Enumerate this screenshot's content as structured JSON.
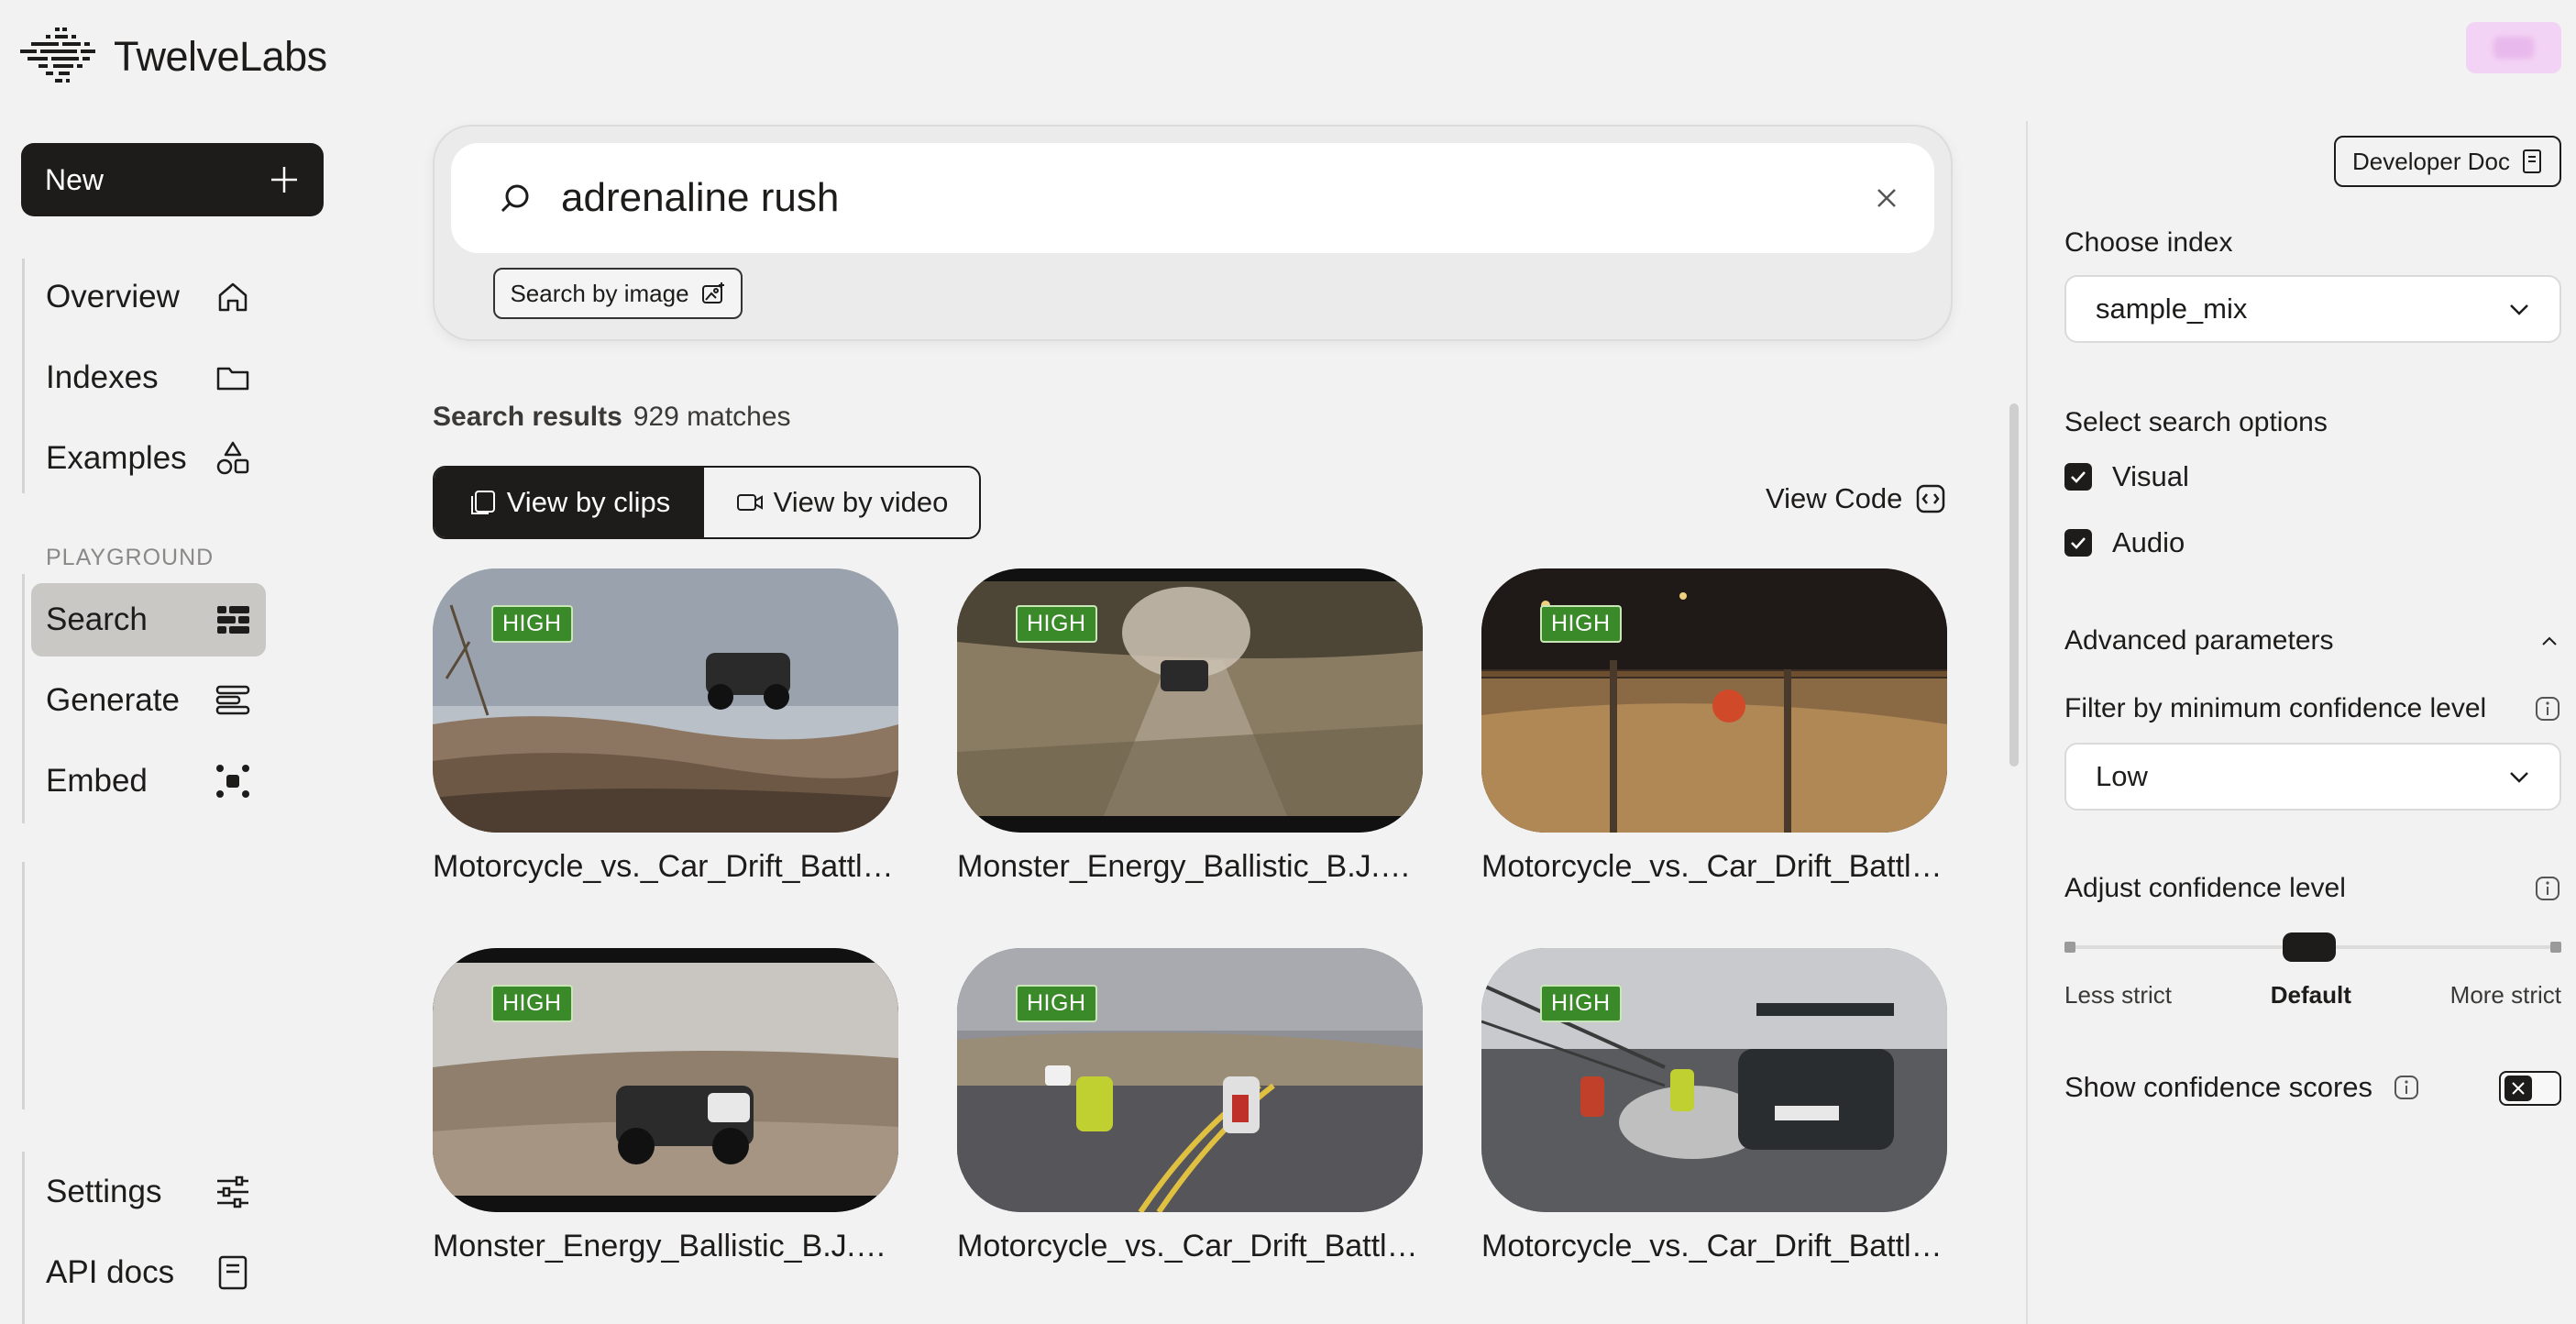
{
  "brand": {
    "name": "TwelveLabs"
  },
  "sidebar": {
    "new_label": "New",
    "items": [
      {
        "label": "Overview"
      },
      {
        "label": "Indexes"
      },
      {
        "label": "Examples"
      }
    ],
    "section_label": "PLAYGROUND",
    "playground": [
      {
        "label": "Search",
        "active": true
      },
      {
        "label": "Generate"
      },
      {
        "label": "Embed"
      }
    ],
    "bottom": [
      {
        "label": "Settings"
      },
      {
        "label": "API docs"
      }
    ]
  },
  "search": {
    "query": "adrenaline rush",
    "image_button": "Search by image"
  },
  "results": {
    "title": "Search results",
    "count": "929 matches",
    "view_clips": "View by clips",
    "view_video": "View by video",
    "view_code": "View Code",
    "items": [
      {
        "title": "Motorcycle_vs._Car_Drift_Battle...",
        "badge": "HIGH"
      },
      {
        "title": "Monster_Energy_Ballistic_B.J._...",
        "badge": "HIGH"
      },
      {
        "title": "Motorcycle_vs._Car_Drift_Battle...",
        "badge": "HIGH"
      },
      {
        "title": "Monster_Energy_Ballistic_B.J._...",
        "badge": "HIGH"
      },
      {
        "title": "Motorcycle_vs._Car_Drift_Battle...",
        "badge": "HIGH"
      },
      {
        "title": "Motorcycle_vs._Car_Drift_Battle...",
        "badge": "HIGH"
      }
    ]
  },
  "panel": {
    "dev_doc": "Developer Doc",
    "choose_index_label": "Choose index",
    "index_value": "sample_mix",
    "search_options_label": "Select search options",
    "options": [
      {
        "label": "Visual",
        "checked": true
      },
      {
        "label": "Audio",
        "checked": true
      }
    ],
    "advanced_label": "Advanced parameters",
    "filter_label": "Filter by minimum confidence level",
    "filter_value": "Low",
    "adjust_label": "Adjust confidence level",
    "slider": {
      "left": "Less strict",
      "mid": "Default",
      "right": "More strict",
      "value": 0.5
    },
    "show_scores_label": "Show confidence scores",
    "show_scores_on": false
  },
  "colors": {
    "accent": "#1d1c1b",
    "badge": "#3b8a2a",
    "active_nav": "#c9c8c5"
  }
}
